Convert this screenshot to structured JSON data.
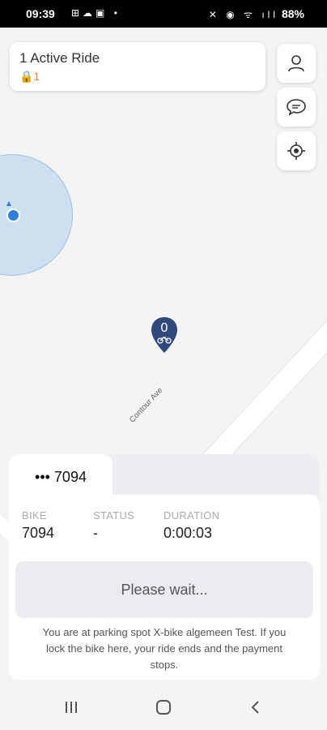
{
  "status_bar": {
    "time": "09:39",
    "left_icons": "⊞☁▣ •",
    "right_icons": "✕ ◉ ᯤ ıll",
    "battery": "88%"
  },
  "map": {
    "street_name": "Contour Ave",
    "bike_marker_count": "0"
  },
  "active_ride_card": {
    "title": "1 Active Ride",
    "lock_count": "🔒1"
  },
  "sheet": {
    "tab_label": "••• 7094",
    "columns": [
      {
        "label": "BIKE",
        "value": "7094"
      },
      {
        "label": "STATUS",
        "value": "-"
      },
      {
        "label": "DURATION",
        "value": "0:00:03"
      }
    ],
    "button_label": "Please wait...",
    "info_text": "You are at parking spot X-bike algemeen Test. If you lock the bike here, your ride ends and the payment stops."
  },
  "colors": {
    "accent_orange": "#e8843a",
    "marker_blue": "#2f4a7a",
    "location_blue": "#2f7ee0"
  },
  "icons": [
    "profile-icon",
    "chat-icon",
    "locate-icon",
    "lock-icon",
    "bike-icon",
    "recents-icon",
    "home-icon",
    "back-icon"
  ]
}
